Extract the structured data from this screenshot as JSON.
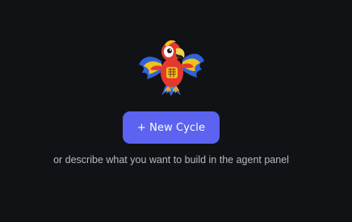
{
  "empty_state": {
    "mascot_icon": "parrot-mascot-icon",
    "new_cycle_label": "+ New Cycle",
    "hint_text": "or describe what you want to build in the agent panel"
  },
  "colors": {
    "background": "#111216",
    "accent": "#5b63f0",
    "hint_text": "#b6b9c4"
  }
}
